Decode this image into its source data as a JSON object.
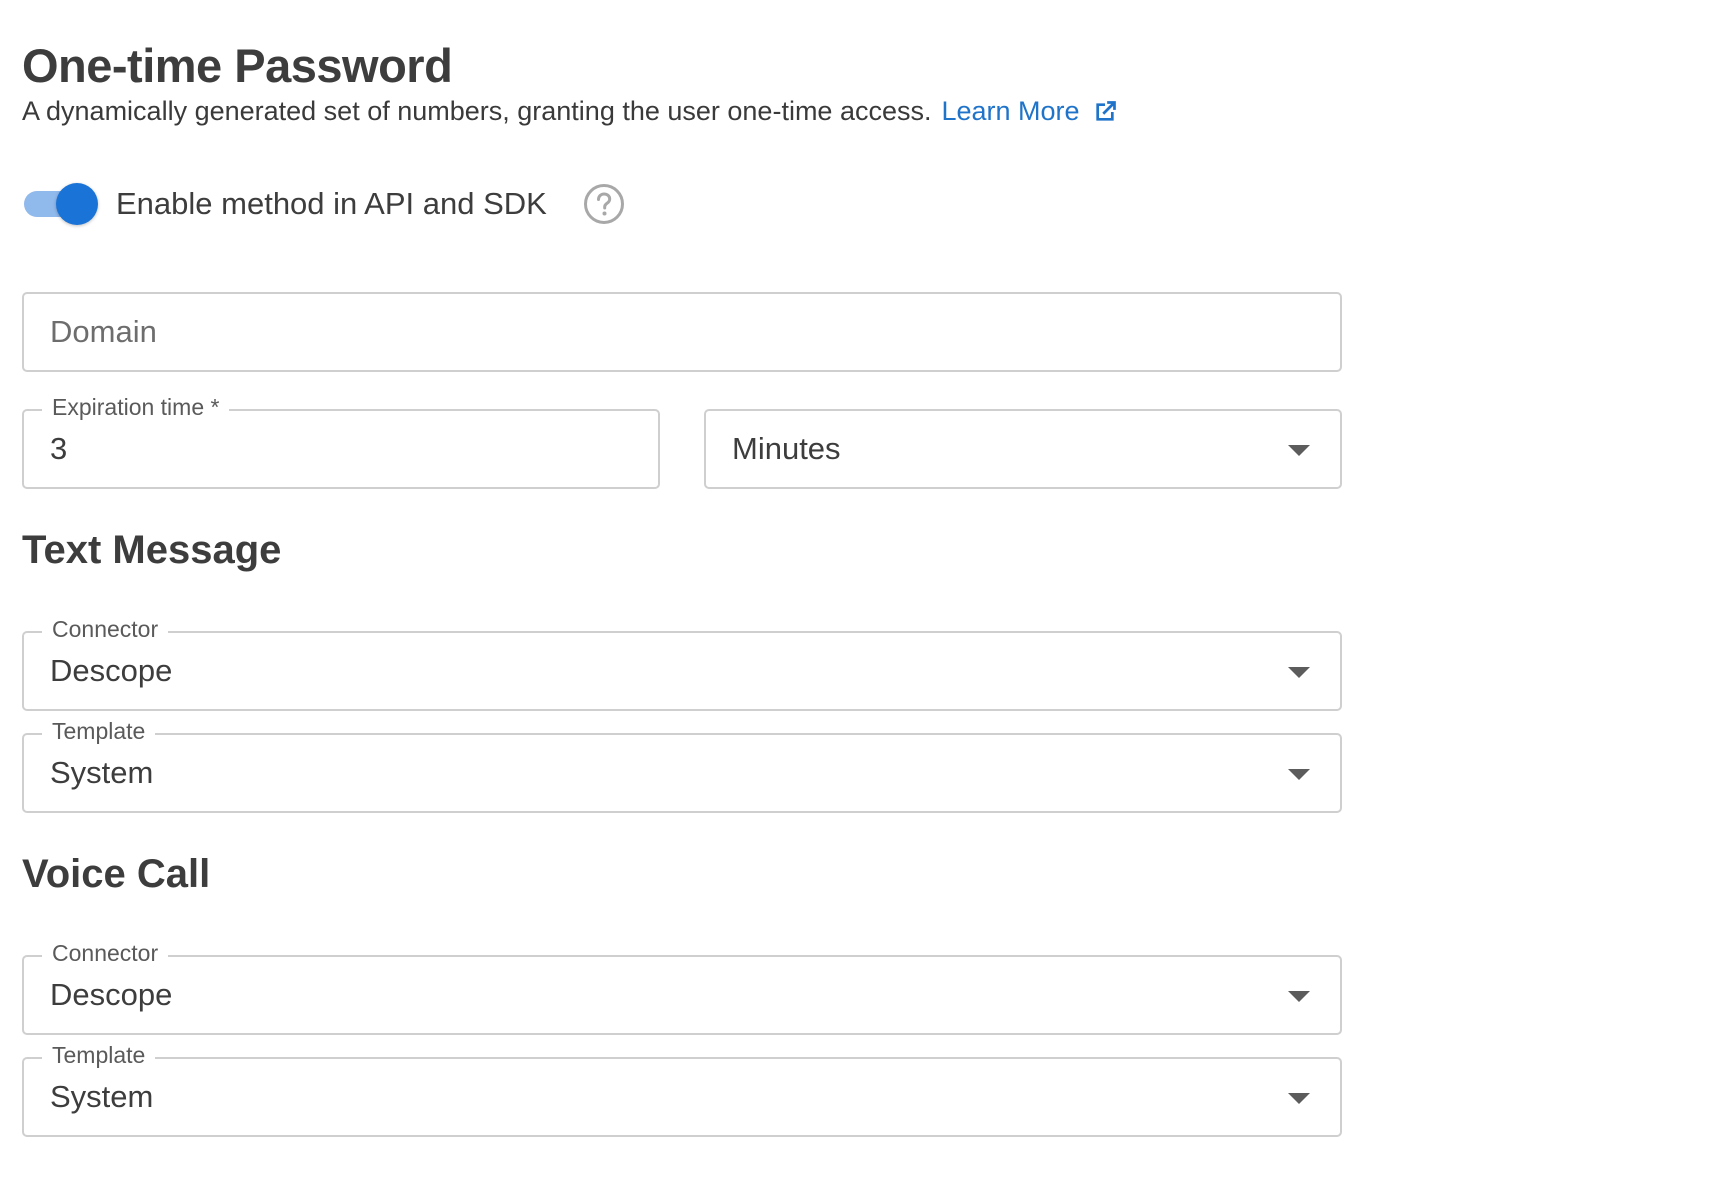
{
  "header": {
    "title": "One-time Password",
    "description": "A dynamically generated set of numbers, granting the user one-time access.",
    "learn_more": "Learn More"
  },
  "enable_toggle": {
    "label": "Enable method in API and SDK",
    "checked": true
  },
  "domain": {
    "placeholder": "Domain",
    "value": ""
  },
  "expiration": {
    "label": "Expiration time *",
    "value": "3",
    "unit": "Minutes"
  },
  "text_message": {
    "title": "Text Message",
    "connector_label": "Connector",
    "connector_value": "Descope",
    "template_label": "Template",
    "template_value": "System"
  },
  "voice_call": {
    "title": "Voice Call",
    "connector_label": "Connector",
    "connector_value": "Descope",
    "template_label": "Template",
    "template_value": "System"
  },
  "colors": {
    "link": "#1f73c9",
    "toggle_thumb": "#1a73d6",
    "toggle_track": "#90b9ec",
    "border": "#cfcfcf"
  }
}
